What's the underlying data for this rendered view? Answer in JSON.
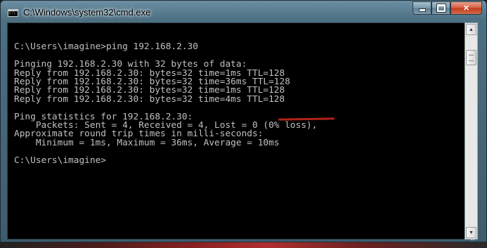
{
  "window": {
    "title": "C:\\Windows\\system32\\cmd.exe",
    "icon": "cmd-icon"
  },
  "controls": {
    "minimize": "minimize-icon",
    "maximize": "maximize-icon",
    "close_glyph": "✕"
  },
  "console": {
    "lines": [
      "",
      "C:\\Users\\imagine>ping 192.168.2.30",
      "",
      "Pinging 192.168.2.30 with 32 bytes of data:",
      "Reply from 192.168.2.30: bytes=32 time=1ms TTL=128",
      "Reply from 192.168.2.30: bytes=32 time=36ms TTL=128",
      "Reply from 192.168.2.30: bytes=32 time=1ms TTL=128",
      "Reply from 192.168.2.30: bytes=32 time=4ms TTL=128",
      "",
      "Ping statistics for 192.168.2.30:",
      "    Packets: Sent = 4, Received = 4, Lost = 0 (0% loss),",
      "Approximate round trip times in milli-seconds:",
      "    Minimum = 1ms, Maximum = 36ms, Average = 10ms",
      "",
      "C:\\Users\\imagine>"
    ]
  },
  "scrollbar": {
    "up_glyph": "▲",
    "down_glyph": "▼"
  },
  "colors": {
    "console_bg": "#000000",
    "console_text": "#c0c0c0",
    "annotation": "#b0221a"
  }
}
